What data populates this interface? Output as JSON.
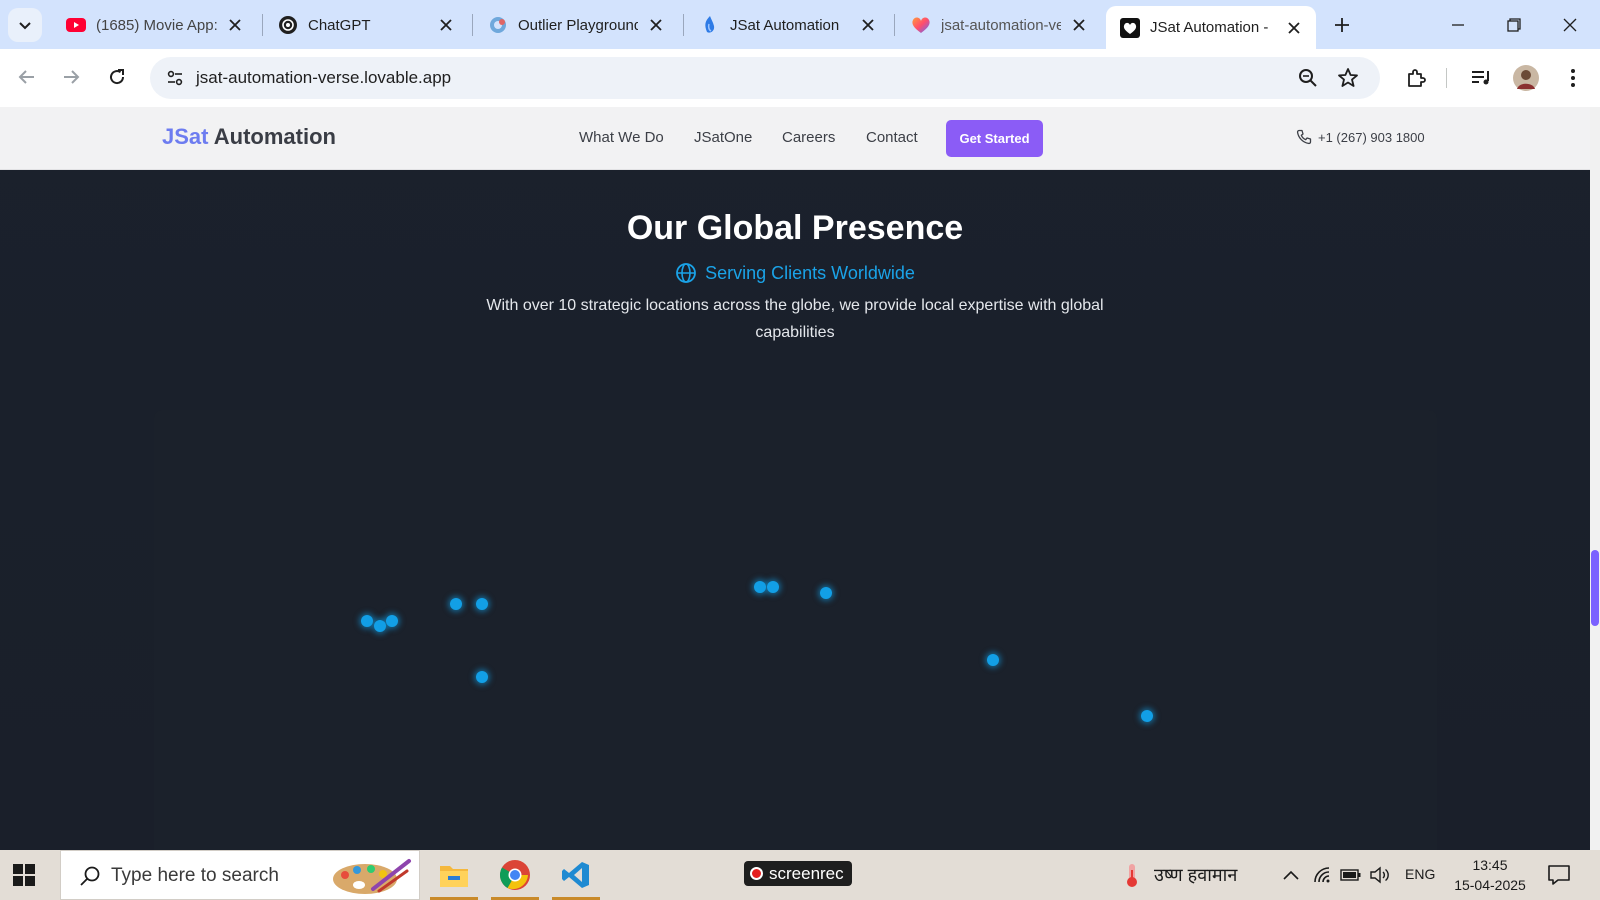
{
  "browser": {
    "tabs": [
      {
        "title": "(1685) Movie App:",
        "favicon": "youtube-icon",
        "active": false
      },
      {
        "title": "ChatGPT",
        "favicon": "chatgpt-icon",
        "active": false
      },
      {
        "title": "Outlier Playground",
        "favicon": "outlier-icon",
        "active": false
      },
      {
        "title": "JSat Automation",
        "favicon": "lovable-icon",
        "active": false
      },
      {
        "title": "jsat-automation-ve",
        "favicon": "lovable-heart-icon",
        "active": false
      },
      {
        "title": "JSat Automation -",
        "favicon": "heart-icon",
        "active": true
      }
    ],
    "url": "jsat-automation-verse.lovable.app"
  },
  "site": {
    "logo_accent": "JSat",
    "logo_rest": " Automation",
    "nav": [
      "What We Do",
      "JSatOne",
      "Careers",
      "Contact"
    ],
    "cta": "Get Started",
    "phone": "+1 (267) 903 1800",
    "colors": {
      "accent": "#8b5cf6",
      "subtitle": "#1aa3e8",
      "dot": "#129fe6",
      "background": "#1b212c"
    }
  },
  "section": {
    "title": "Our Global Presence",
    "subtitle": "Serving Clients Worldwide",
    "description": "With over 10 strategic locations across the globe, we provide local expertise with global capabilities"
  },
  "taskbar": {
    "search_placeholder": "Type here to search",
    "recorder": "screenrec",
    "weather": "उष्ण हवामान",
    "language": "ENG",
    "time": "13:45",
    "date": "15-04-2025",
    "apps": [
      "file-explorer-icon",
      "chrome-icon",
      "vscode-icon"
    ]
  }
}
